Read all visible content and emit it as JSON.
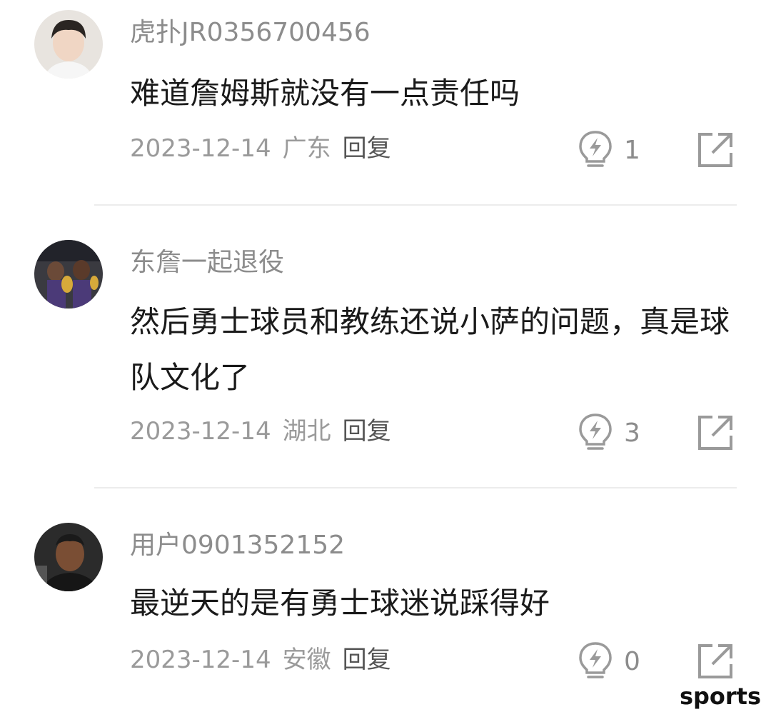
{
  "comments": [
    {
      "username": "虎扑JR0356700456",
      "content": "难道詹姆斯就没有一点责任吗",
      "date": "2023-12-14",
      "region": "广东",
      "reply_label": "回复",
      "likes": "1"
    },
    {
      "username": "东詹一起退役",
      "content": "然后勇士球员和教练还说小萨的问题，真是球队文化了",
      "date": "2023-12-14",
      "region": "湖北",
      "reply_label": "回复",
      "likes": "3"
    },
    {
      "username": "用户0901352152",
      "content": "最逆天的是有勇士球迷说踩得好",
      "date": "2023-12-14",
      "region": "安徽",
      "reply_label": "回复",
      "likes": "0"
    }
  ],
  "icons": {
    "like": "lightbulb-lightning-icon",
    "share": "share-arrow-icon"
  },
  "watermark": "sports",
  "colors": {
    "username": "#8c8c8c",
    "text": "#1a1a1a",
    "meta": "#9a9a9a",
    "icon": "#9a9a9a"
  }
}
